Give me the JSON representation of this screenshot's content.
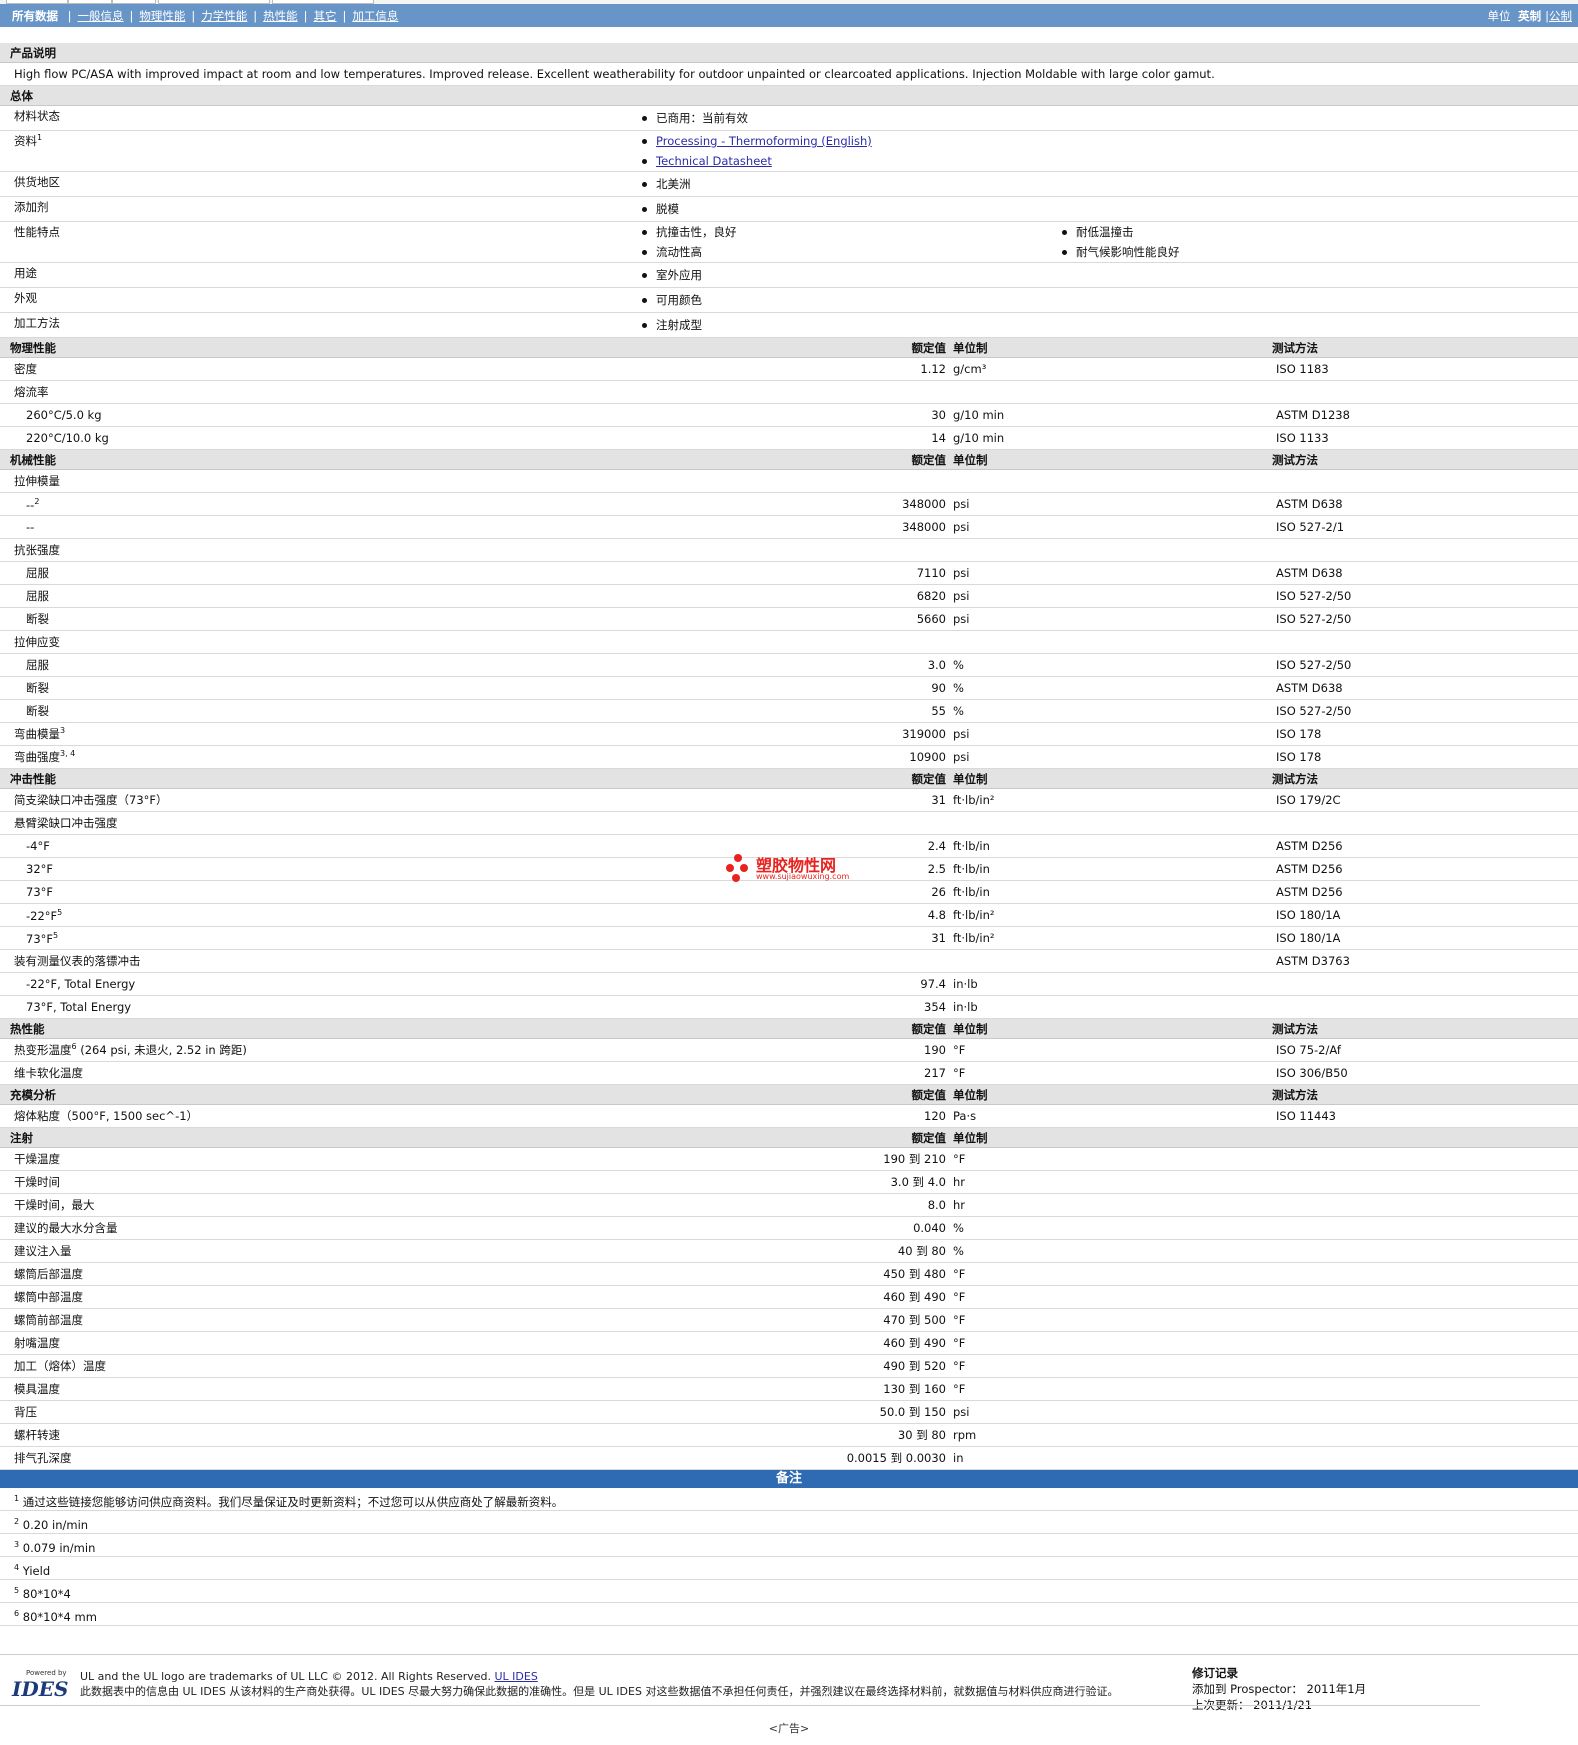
{
  "nav": {
    "active": "所有数据",
    "links": [
      "一般信息",
      "物理性能",
      "力学性能",
      "热性能",
      "其它",
      "加工信息"
    ],
    "units_label": "单位",
    "units_active": "英制",
    "units_other": "公制"
  },
  "description": {
    "title": "产品说明",
    "text": "High flow PC/ASA with improved impact at room and low temperatures. Improved release. Excellent weatherability for outdoor unpainted or clearcoated applications. Injection Moldable with large color gamut."
  },
  "general": {
    "title": "总体",
    "rows": [
      {
        "label": "材料状态",
        "items": [
          "已商用：当前有效"
        ]
      },
      {
        "label": "资料",
        "sup": "1",
        "links": [
          "Processing - Thermoforming (English)",
          "Technical Datasheet"
        ]
      },
      {
        "label": "供货地区",
        "items": [
          "北美洲"
        ]
      },
      {
        "label": "添加剂",
        "items": [
          "脱模"
        ]
      },
      {
        "label": "性能特点",
        "items": [
          "抗撞击性，良好",
          "流动性高"
        ],
        "items2": [
          "耐低温撞击",
          "耐气候影响性能良好"
        ]
      },
      {
        "label": "用途",
        "items": [
          "室外应用"
        ]
      },
      {
        "label": "外观",
        "items": [
          "可用颜色"
        ]
      },
      {
        "label": "加工方法",
        "items": [
          "注射成型"
        ]
      }
    ]
  },
  "headers": {
    "value": "额定值",
    "unit": "单位制",
    "method": "测试方法"
  },
  "sections": [
    {
      "title": "物理性能",
      "has_method": true,
      "rows": [
        {
          "label": "密度",
          "value": "1.12",
          "unit": "g/cm³",
          "method": "ISO 1183"
        },
        {
          "label": "熔流率",
          "group": true
        },
        {
          "label": "260°C/5.0 kg",
          "sub": true,
          "value": "30",
          "unit": "g/10 min",
          "method": "ASTM D1238"
        },
        {
          "label": "220°C/10.0 kg",
          "sub": true,
          "value": "14",
          "unit": "g/10 min",
          "method": "ISO 1133"
        }
      ]
    },
    {
      "title": "机械性能",
      "has_method": true,
      "rows": [
        {
          "label": "拉伸模量",
          "group": true
        },
        {
          "label": "--",
          "sup": "2",
          "sub": true,
          "value": "348000",
          "unit": "psi",
          "method": "ASTM D638"
        },
        {
          "label": "--",
          "sub": true,
          "value": "348000",
          "unit": "psi",
          "method": "ISO 527-2/1"
        },
        {
          "label": "抗张强度",
          "group": true
        },
        {
          "label": "屈服",
          "sub": true,
          "value": "7110",
          "unit": "psi",
          "method": "ASTM D638"
        },
        {
          "label": "屈服",
          "sub": true,
          "value": "6820",
          "unit": "psi",
          "method": "ISO 527-2/50"
        },
        {
          "label": "断裂",
          "sub": true,
          "value": "5660",
          "unit": "psi",
          "method": "ISO 527-2/50"
        },
        {
          "label": "拉伸应变",
          "group": true
        },
        {
          "label": "屈服",
          "sub": true,
          "value": "3.0",
          "unit": "%",
          "method": "ISO 527-2/50"
        },
        {
          "label": "断裂",
          "sub": true,
          "value": "90",
          "unit": "%",
          "method": "ASTM D638"
        },
        {
          "label": "断裂",
          "sub": true,
          "value": "55",
          "unit": "%",
          "method": "ISO 527-2/50"
        },
        {
          "label": "弯曲模量",
          "sup": "3",
          "value": "319000",
          "unit": "psi",
          "method": "ISO 178"
        },
        {
          "label": "弯曲强度",
          "sup": "3, 4",
          "value": "10900",
          "unit": "psi",
          "method": "ISO 178"
        }
      ]
    },
    {
      "title": "冲击性能",
      "has_method": true,
      "rows": [
        {
          "label": "简支梁缺口冲击强度（73°F）",
          "value": "31",
          "unit": "ft·lb/in²",
          "method": "ISO 179/2C"
        },
        {
          "label": "悬臂梁缺口冲击强度",
          "group": true
        },
        {
          "label": "-4°F",
          "sub": true,
          "value": "2.4",
          "unit": "ft·lb/in",
          "method": "ASTM D256"
        },
        {
          "label": "32°F",
          "sub": true,
          "value": "2.5",
          "unit": "ft·lb/in",
          "method": "ASTM D256"
        },
        {
          "label": "73°F",
          "sub": true,
          "value": "26",
          "unit": "ft·lb/in",
          "method": "ASTM D256"
        },
        {
          "label": "-22°F",
          "sup": "5",
          "sub": true,
          "value": "4.8",
          "unit": "ft·lb/in²",
          "method": "ISO 180/1A"
        },
        {
          "label": "73°F",
          "sup": "5",
          "sub": true,
          "value": "31",
          "unit": "ft·lb/in²",
          "method": "ISO 180/1A"
        },
        {
          "label": "装有测量仪表的落镖冲击",
          "group": true,
          "method": "ASTM D3763"
        },
        {
          "label": "-22°F, Total Energy",
          "sub": true,
          "value": "97.4",
          "unit": "in·lb",
          "method": ""
        },
        {
          "label": "73°F, Total Energy",
          "sub": true,
          "value": "354",
          "unit": "in·lb",
          "method": ""
        }
      ]
    },
    {
      "title": "热性能",
      "has_method": true,
      "rows": [
        {
          "label": "热变形温度",
          "sup": "6",
          "extra": "(264 psi, 未退火, 2.52 in 跨距)",
          "value": "190",
          "unit": "°F",
          "method": "ISO 75-2/Af"
        },
        {
          "label": "维卡软化温度",
          "value": "217",
          "unit": "°F",
          "method": "ISO 306/B50"
        }
      ]
    },
    {
      "title": "充模分析",
      "has_method": true,
      "rows": [
        {
          "label": "熔体粘度（500°F, 1500 sec^-1）",
          "value": "120",
          "unit": "Pa·s",
          "method": "ISO 11443"
        }
      ]
    },
    {
      "title": "注射",
      "has_method": false,
      "rows": [
        {
          "label": "干燥温度",
          "value": "190 到  210",
          "unit": "°F"
        },
        {
          "label": "干燥时间",
          "value": "3.0 到  4.0",
          "unit": "hr"
        },
        {
          "label": "干燥时间，最大",
          "value": "8.0",
          "unit": "hr"
        },
        {
          "label": "建议的最大水分含量",
          "value": "0.040",
          "unit": "%"
        },
        {
          "label": "建议注入量",
          "value": "40 到  80",
          "unit": "%"
        },
        {
          "label": "螺筒后部温度",
          "value": "450 到  480",
          "unit": "°F"
        },
        {
          "label": "螺筒中部温度",
          "value": "460 到  490",
          "unit": "°F"
        },
        {
          "label": "螺筒前部温度",
          "value": "470 到  500",
          "unit": "°F"
        },
        {
          "label": "射嘴温度",
          "value": "460 到  490",
          "unit": "°F"
        },
        {
          "label": "加工（熔体）温度",
          "value": "490 到  520",
          "unit": "°F"
        },
        {
          "label": "模具温度",
          "value": "130 到  160",
          "unit": "°F"
        },
        {
          "label": "背压",
          "value": "50.0 到  150",
          "unit": "psi"
        },
        {
          "label": "螺杆转速",
          "value": "30 到  80",
          "unit": "rpm"
        },
        {
          "label": "排气孔深度",
          "value": "0.0015 到  0.0030",
          "unit": "in"
        }
      ]
    }
  ],
  "notes": {
    "title": "备注",
    "items": [
      {
        "n": "1",
        "text": "通过这些链接您能够访问供应商资料。我们尽量保证及时更新资料；不过您可以从供应商处了解最新资料。"
      },
      {
        "n": "2",
        "text": "0.20 in/min"
      },
      {
        "n": "3",
        "text": "0.079 in/min"
      },
      {
        "n": "4",
        "text": "Yield"
      },
      {
        "n": "5",
        "text": "80*10*4"
      },
      {
        "n": "6",
        "text": "80*10*4 mm"
      }
    ]
  },
  "watermark": {
    "title": "塑胶物性网",
    "url": "www.sujiaowuxing.com"
  },
  "footer": {
    "powered": "Powered by",
    "logo": "IDES",
    "line1": "UL and the UL logo are trademarks of UL LLC © 2012. All Rights Reserved.",
    "line1_link": "UL IDES",
    "line2": "此数据表中的信息由 UL IDES 从该材料的生产商处获得。UL IDES 尽最大努力确保此数据的准确性。但是 UL IDES 对这些数据值不承担任何责任，并强烈建议在最终选择材料前，就数据值与材料供应商进行验证。",
    "rev_title": "修订记录",
    "rev_added": "添加到 Prospector：  2011年1月",
    "rev_updated": "上次更新：  2011/1/21",
    "ad": "<广告>"
  }
}
